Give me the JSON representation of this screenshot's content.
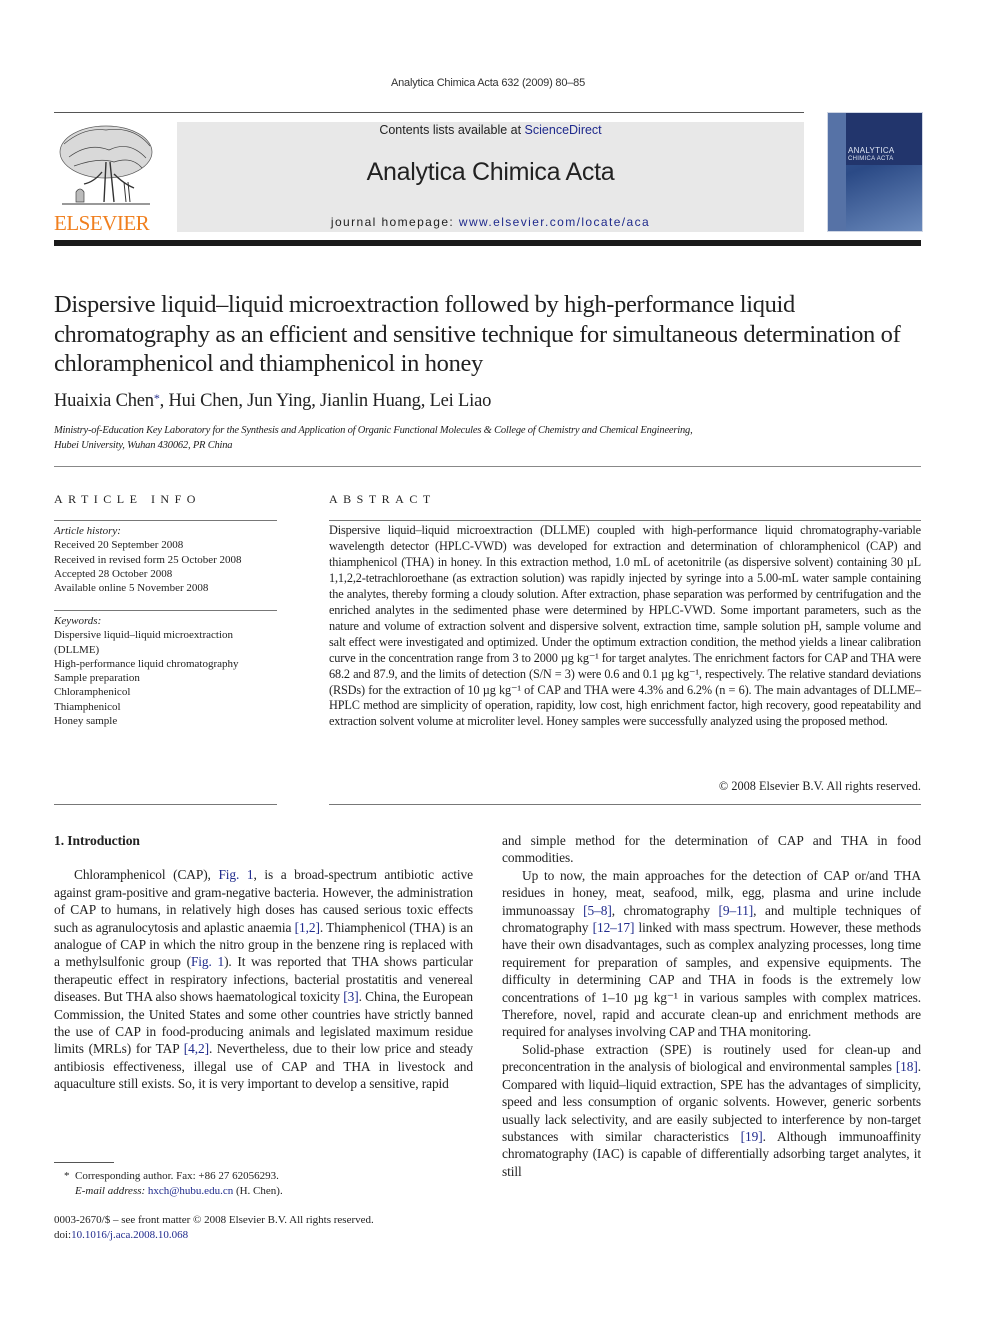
{
  "header": {
    "running_head": "Analytica Chimica Acta 632 (2009) 80–85",
    "contents_prefix": "Contents lists available at ",
    "contents_link": "ScienceDirect",
    "journal_name": "Analytica Chimica Acta",
    "homepage_prefix": "journal homepage: ",
    "homepage_link": "www.elsevier.com/locate/aca",
    "publisher_logo_text": "ELSEVIER",
    "cover_title_line1": "ANALYTICA",
    "cover_title_line2": "CHIMICA ACTA",
    "colors": {
      "publisher_orange": "#f07f1e",
      "link_blue": "#1f2a8c",
      "masthead_gray": "#e8e8e8"
    }
  },
  "article": {
    "title": "Dispersive liquid–liquid microextraction followed by high-performance liquid chromatography as an efficient and sensitive technique for simultaneous determination of chloramphenicol and thiamphenicol in honey",
    "authors": [
      {
        "name": "Huaixia Chen",
        "corresponding_mark": "*"
      },
      {
        "name": "Hui Chen"
      },
      {
        "name": "Jun Ying"
      },
      {
        "name": "Jianlin Huang"
      },
      {
        "name": "Lei Liao"
      }
    ],
    "authors_rest": ", Hui Chen, Jun Ying, Jianlin Huang, Lei Liao",
    "affiliation_line1": "Ministry-of-Education Key Laboratory for the Synthesis and Application of Organic Functional Molecules & College of Chemistry and Chemical Engineering,",
    "affiliation_line2": "Hubei University, Wuhan 430062, PR China"
  },
  "article_info": {
    "heading": "ARTICLE INFO",
    "history_label": "Article history:",
    "history": [
      "Received 20 September 2008",
      "Received in revised form 25 October 2008",
      "Accepted 28 October 2008",
      "Available online 5 November 2008"
    ],
    "keywords_label": "Keywords:",
    "keywords": [
      "Dispersive liquid–liquid microextraction (DLLME)",
      "High-performance liquid chromatography",
      "Sample preparation",
      "Chloramphenicol",
      "Thiamphenicol",
      "Honey sample"
    ]
  },
  "abstract": {
    "heading": "ABSTRACT",
    "text": "Dispersive liquid–liquid microextraction (DLLME) coupled with high-performance liquid chromatography-variable wavelength detector (HPLC-VWD) was developed for extraction and determination of chloramphenicol (CAP) and thiamphenicol (THA) in honey. In this extraction method, 1.0 mL of acetonitrile (as dispersive solvent) containing 30 µL 1,1,2,2-tetrachloroethane (as extraction solution) was rapidly injected by syringe into a 5.00-mL water sample containing the analytes, thereby forming a cloudy solution. After extraction, phase separation was performed by centrifugation and the enriched analytes in the sedimented phase were determined by HPLC-VWD. Some important parameters, such as the nature and volume of extraction solvent and dispersive solvent, extraction time, sample solution pH, sample volume and salt effect were investigated and optimized. Under the optimum extraction condition, the method yields a linear calibration curve in the concentration range from 3 to 2000 µg kg⁻¹ for target analytes. The enrichment factors for CAP and THA were 68.2 and 87.9, and the limits of detection (S/N = 3) were 0.6 and 0.1 µg kg⁻¹, respectively. The relative standard deviations (RSDs) for the extraction of 10 µg kg⁻¹ of CAP and THA were 4.3% and 6.2% (n = 6). The main advantages of DLLME–HPLC method are simplicity of operation, rapidity, low cost, high enrichment factor, high recovery, good repeatability and extraction solvent volume at microliter level. Honey samples were successfully analyzed using the proposed method.",
    "copyright": "© 2008 Elsevier B.V. All rights reserved."
  },
  "body": {
    "section_heading": "1.  Introduction",
    "left_column": {
      "p1_a": "Chloramphenicol (CAP), ",
      "p1_ref_fig1": "Fig. 1",
      "p1_b": ", is a broad-spectrum antibiotic active against gram-positive and gram-negative bacteria. However, the administration of CAP to humans, in relatively high doses has caused serious toxic effects such as agranulocytosis and aplastic anaemia ",
      "p1_ref_1_2": "[1,2]",
      "p1_c": ". Thiamphenicol (THA) is an analogue of CAP in which the nitro group in the benzene ring is replaced with a methylsulfonic group (",
      "p1_ref_fig1b": "Fig. 1",
      "p1_d": "). It was reported that THA shows particular therapeutic effect in respiratory infections, bacterial prostatitis and venereal diseases. But THA also shows haematological toxicity ",
      "p1_ref_3": "[3]",
      "p1_e": ". China, the European Commission, the United States and some other countries have strictly banned the use of CAP in food-producing animals and legislated maximum residue limits (MRLs) for TAP ",
      "p1_ref_4_2": "[4,2]",
      "p1_f": ". Nevertheless, due to their low price and steady antibiosis effectiveness, illegal use of CAP and THA in livestock and aquaculture still exists. So, it is very important to develop a sensitive, rapid"
    },
    "right_column": {
      "p0": "and simple method for the determination of CAP and THA in food commodities.",
      "p2_a": "Up to now, the main approaches for the detection of CAP or/and THA residues in honey, meat, seafood, milk, egg, plasma and urine include immunoassay ",
      "p2_ref_5_8": "[5–8]",
      "p2_b": ", chromatography ",
      "p2_ref_9_11": "[9–11]",
      "p2_c": ", and multiple techniques of chromatography ",
      "p2_ref_12_17": "[12–17]",
      "p2_d": " linked with mass spectrum. However, these methods have their own disadvantages, such as complex analyzing processes, long time requirement for preparation of samples, and expensive equipments. The difficulty in determining CAP and THA in foods is the extremely low concentrations of 1–10 µg kg⁻¹ in various samples with complex matrices. Therefore, novel, rapid and accurate clean-up and enrichment methods are required for analyses involving CAP and THA monitoring.",
      "p3_a": "Solid-phase extraction (SPE) is routinely used for clean-up and preconcentration in the analysis of biological and environmental samples ",
      "p3_ref_18": "[18]",
      "p3_b": ". Compared with liquid–liquid extraction, SPE has the advantages of simplicity, speed and less consumption of organic solvents. However, generic sorbents usually lack selectivity, and are easily subjected to interference by non-target substances with similar characteristics ",
      "p3_ref_19": "[19]",
      "p3_c": ". Although immunoaffinity chromatography (IAC) is capable of differentially adsorbing target analytes, it still"
    }
  },
  "footnotes": {
    "mark": "*",
    "corresponding": "Corresponding author. Fax: +86 27 62056293.",
    "email_label": "E-mail address: ",
    "email": "hxch@hubu.edu.cn",
    "email_suffix": " (H. Chen).",
    "issn_line": "0003-2670/$ – see front matter © 2008 Elsevier B.V. All rights reserved.",
    "doi_prefix": "doi:",
    "doi": "10.1016/j.aca.2008.10.068"
  }
}
